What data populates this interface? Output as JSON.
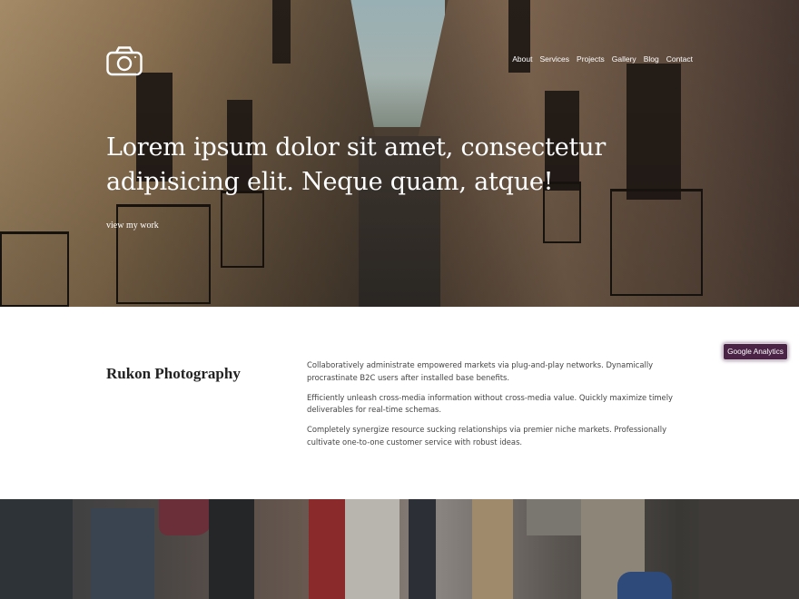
{
  "site": {
    "nav": [
      "About",
      "Services",
      "Projects",
      "Gallery",
      "Blog",
      "Contact"
    ],
    "logo_icon": "camera-icon"
  },
  "hero": {
    "title": "Lorem ipsum dolor sit amet, consectetur adipisicing elit. Neque quam, atque!",
    "link_label": "view my work"
  },
  "about": {
    "title": "Rukon Photography",
    "paragraphs": [
      "Collaboratively administrate empowered markets via plug-and-play networks. Dynamically procrastinate B2C users after installed base benefits.",
      "Efficiently unleash cross-media information without cross-media value. Quickly maximize timely deliverables for real-time schemas.",
      "Completely synergize resource sucking relationships via premier niche markets. Professionally cultivate one-to-one customer service with robust ideas."
    ]
  },
  "badge": {
    "label": "Google Analytics",
    "color": "#4b2347"
  }
}
